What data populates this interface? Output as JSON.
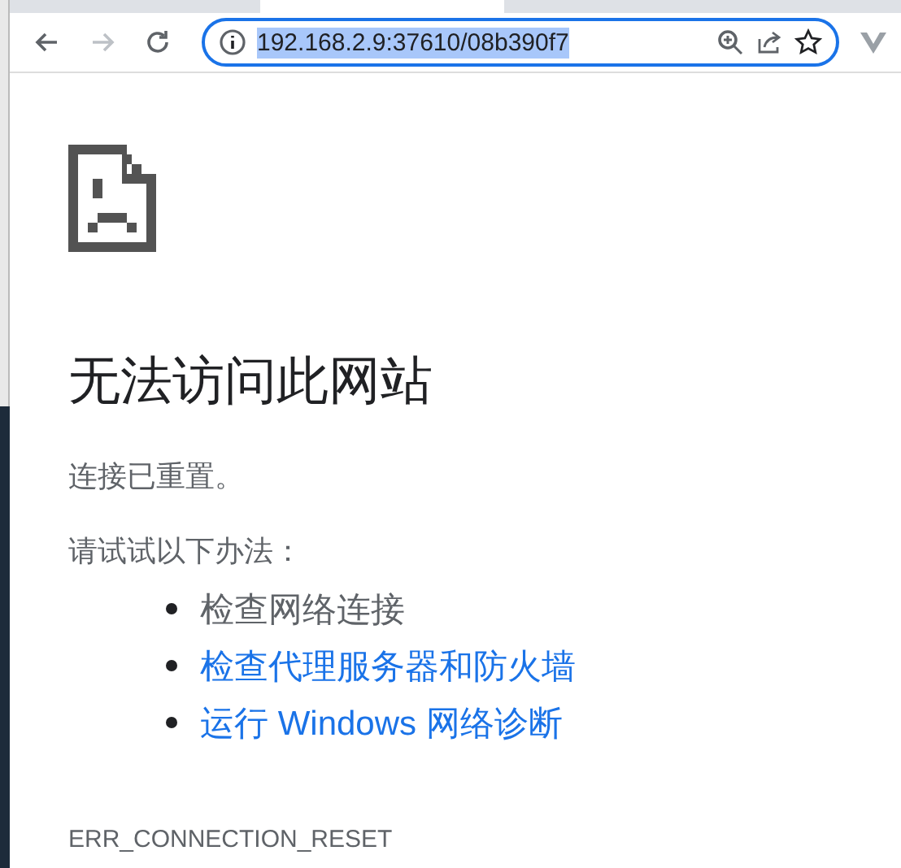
{
  "toolbar": {
    "back_disabled": false,
    "forward_disabled": true,
    "url": "192.168.2.9:37610/08b390f7",
    "url_selected": true
  },
  "error": {
    "title": "无法访问此网站",
    "message": "连接已重置。",
    "suggestions_heading": "请试试以下办法：",
    "suggestions": [
      {
        "text": "检查网络连接",
        "kind": "plain"
      },
      {
        "text": "检查代理服务器和防火墙",
        "kind": "link"
      },
      {
        "text": "运行 Windows 网络诊断",
        "kind": "link"
      }
    ],
    "code": "ERR_CONNECTION_RESET"
  }
}
